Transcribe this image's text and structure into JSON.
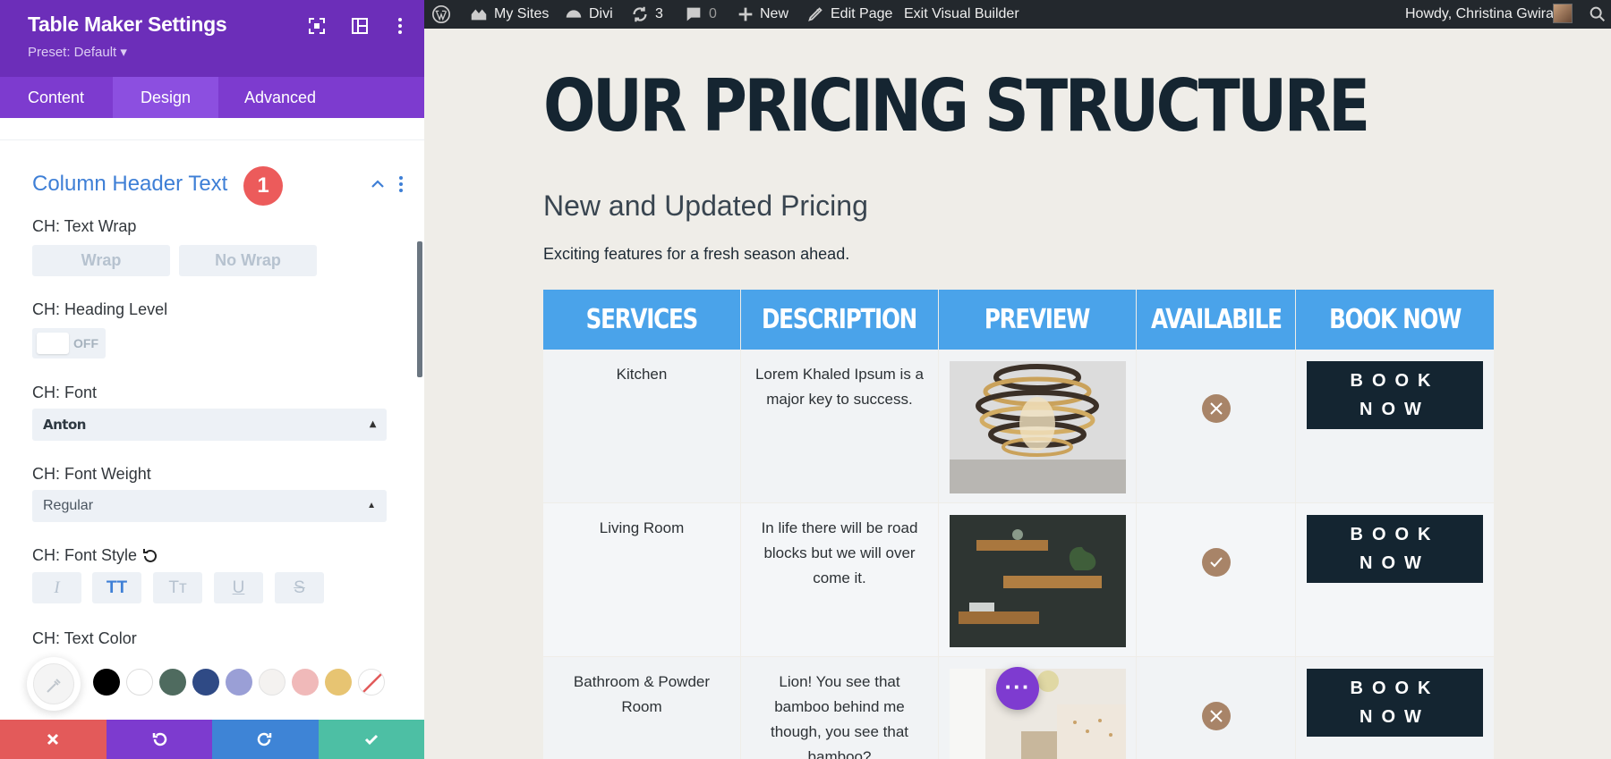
{
  "panel": {
    "title": "Table Maker Settings",
    "preset": "Preset: Default ▾",
    "tabs": [
      "Content",
      "Design",
      "Advanced"
    ],
    "active_tab": "Design",
    "section": {
      "title": "Column Header Text",
      "badge": "1"
    },
    "fields": {
      "text_wrap_label": "CH: Text Wrap",
      "wrap_option": "Wrap",
      "nowrap_option": "No Wrap",
      "heading_level_label": "CH: Heading Level",
      "heading_toggle": "OFF",
      "font_label": "CH: Font",
      "font_value": "Anton",
      "font_weight_label": "CH: Font Weight",
      "font_weight_value": "Regular",
      "font_style_label": "CH: Font Style",
      "font_style_buttons": [
        "I",
        "TT",
        "Tт",
        "U",
        "S"
      ],
      "text_color_label": "CH: Text Color"
    },
    "swatches": [
      "#000000",
      "#ffffff",
      "#4f6b5f",
      "#2f4a85",
      "#9a9fd6",
      "#f4f2f0",
      "#f0b9b9",
      "#e7c472",
      "none"
    ],
    "footer_colors": {
      "cancel": "#e35a5a",
      "undo": "#7d3bcf",
      "redo": "#3e84d6",
      "save": "#4dbfa4"
    }
  },
  "adminbar": {
    "my_sites": "My Sites",
    "divi": "Divi",
    "updates_count": "3",
    "comments_count": "0",
    "new": "New",
    "edit_page": "Edit Page",
    "exit_builder": "Exit Visual Builder",
    "greeting": "Howdy, Christina Gwira"
  },
  "page": {
    "title": "OUR PRICING STRUCTURE",
    "subtitle": "New and Updated Pricing",
    "lead": "Exciting features for a fresh season ahead.",
    "table": {
      "headers": [
        "SERVICES",
        "DESCRIPTION",
        "PREVIEW",
        "AVAILABILE",
        "BOOK NOW"
      ],
      "rows": [
        {
          "service": "Kitchen",
          "description": "Lorem Khaled Ipsum is a major key to success.",
          "available": false,
          "button": "BOOK NOW"
        },
        {
          "service": "Living Room",
          "description": "In life there will be road blocks but we will over come it.",
          "available": true,
          "button": "BOOK NOW"
        },
        {
          "service": "Bathroom & Powder Room",
          "description": "Lion! You see that bamboo behind me though, you see that bamboo?",
          "available": false,
          "button": "BOOK NOW"
        }
      ]
    },
    "colors": {
      "header_bg": "#4aa3ea",
      "button_bg": "#142531",
      "icon_bg": "#a88468",
      "title": "#152531"
    }
  }
}
